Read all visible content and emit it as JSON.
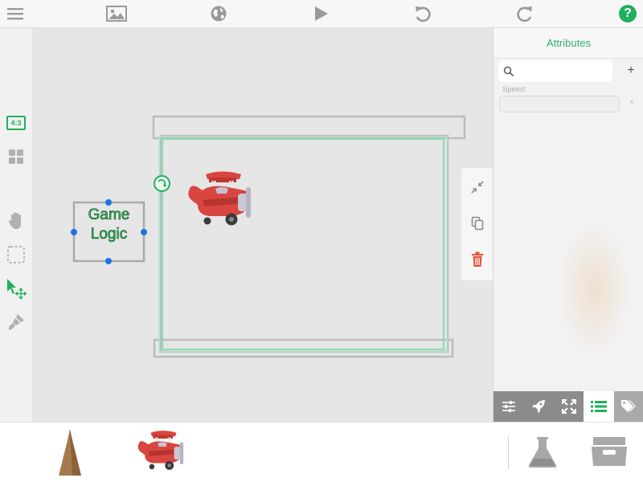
{
  "toolbar": {
    "items": [
      {
        "name": "menu-icon"
      },
      {
        "name": "image-icon"
      },
      {
        "name": "globe-icon"
      },
      {
        "name": "play-icon"
      },
      {
        "name": "undo-icon"
      },
      {
        "name": "redo-icon"
      },
      {
        "name": "help-icon",
        "glyph": "?"
      }
    ]
  },
  "left_tools": {
    "aspect_label": "4:3",
    "items": [
      "aspect-ratio-icon",
      "grid-icon",
      "hand-icon",
      "marquee-select-icon",
      "pointer-move-icon",
      "brush-icon"
    ]
  },
  "canvas": {
    "game_logic_label_line1": "Game",
    "game_logic_label_line2": "Logic",
    "floating_tools": [
      "collapse-icon",
      "duplicate-icon",
      "trash-icon"
    ]
  },
  "attributes_panel": {
    "title": "Attributes",
    "search_placeholder": "",
    "add_glyph": "+",
    "speed_label": "Speed:",
    "speed_value": "",
    "clear_glyph": "×",
    "tabs": [
      "sliders-icon",
      "rocket-icon",
      "expand-icon",
      "list-icon",
      "tags-icon"
    ],
    "active_tab": "list-icon"
  },
  "tray": {
    "items": [
      "mountain-sprite",
      "biplane-sprite",
      "lab-flask-icon",
      "archive-drawer-icon"
    ]
  },
  "colors": {
    "accent": "#2eaf6f",
    "handle": "#1a73e8",
    "danger": "#e5533d",
    "tab_bar": "#8c8c8c"
  }
}
